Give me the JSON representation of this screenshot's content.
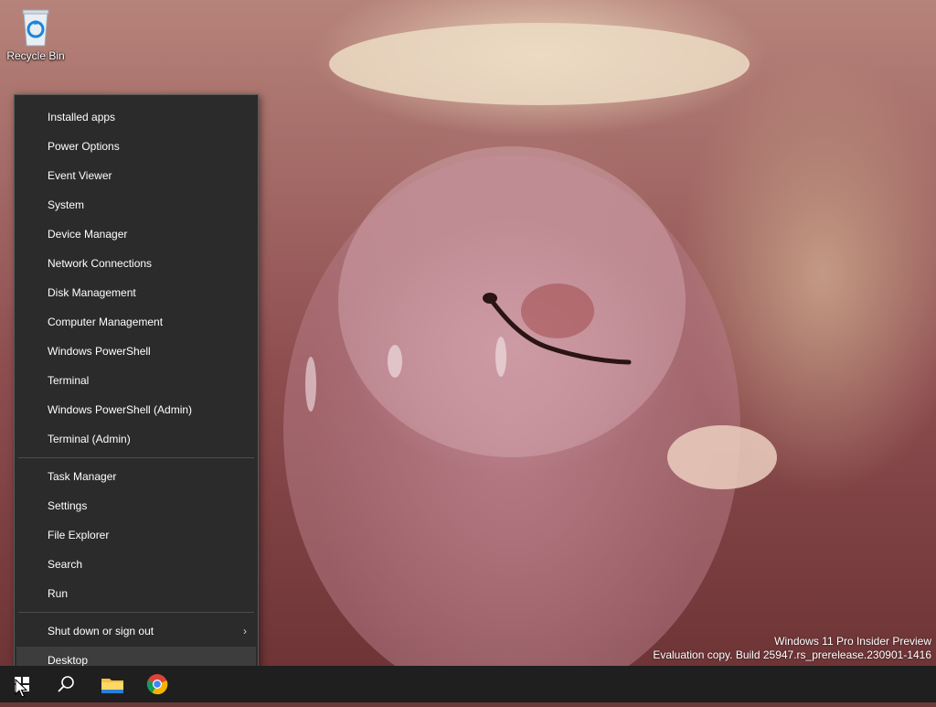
{
  "desktop": {
    "icons": [
      {
        "label": "Recycle Bin",
        "icon": "recycle-bin-icon"
      }
    ]
  },
  "context_menu": {
    "groups": [
      [
        "Installed apps",
        "Power Options",
        "Event Viewer",
        "System",
        "Device Manager",
        "Network Connections",
        "Disk Management",
        "Computer Management",
        "Windows PowerShell",
        "Terminal",
        "Windows PowerShell (Admin)",
        "Terminal (Admin)"
      ],
      [
        "Task Manager",
        "Settings",
        "File Explorer",
        "Search",
        "Run"
      ],
      [
        "Shut down or sign out",
        "Desktop"
      ]
    ],
    "submenu_arrow": "›",
    "hovered_item": "Desktop"
  },
  "watermark": {
    "line1": "Windows 11 Pro Insider Preview",
    "line2": "Evaluation copy. Build 25947.rs_prerelease.230901-1416"
  },
  "taskbar": {
    "buttons": [
      "start-icon",
      "search-icon",
      "file-explorer-icon",
      "chrome-icon"
    ]
  },
  "colors": {
    "menu_bg": "#2b2b2b",
    "menu_border": "#5a5a5a",
    "taskbar_bg": "#1f1f1f",
    "text": "#ffffff"
  }
}
